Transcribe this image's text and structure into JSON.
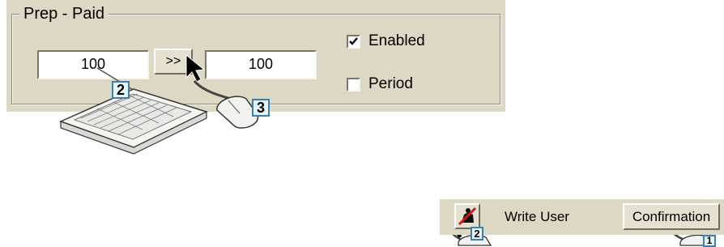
{
  "prep_paid": {
    "group_title": "Prep - Paid",
    "first_value": "100",
    "transfer_button": ">>",
    "second_value": "100",
    "enabled_label": "Enabled",
    "enabled_checked": true,
    "period_label": "Period",
    "period_checked": false
  },
  "top_steps": {
    "keyboard_step": "2",
    "mouse_step": "3"
  },
  "user_strip": {
    "write_user_label": "Write User",
    "write_user_icon": "write-user-icon",
    "confirmation_button": "Confirmation"
  },
  "bottom_steps": {
    "write_step": "2",
    "confirm_step": "1"
  },
  "colors": {
    "panel_bg": "#dcd8c4",
    "step_label_bg": "#e6f4fc",
    "step_label_border": "#3f7fb0",
    "icon_red": "#d01818"
  }
}
